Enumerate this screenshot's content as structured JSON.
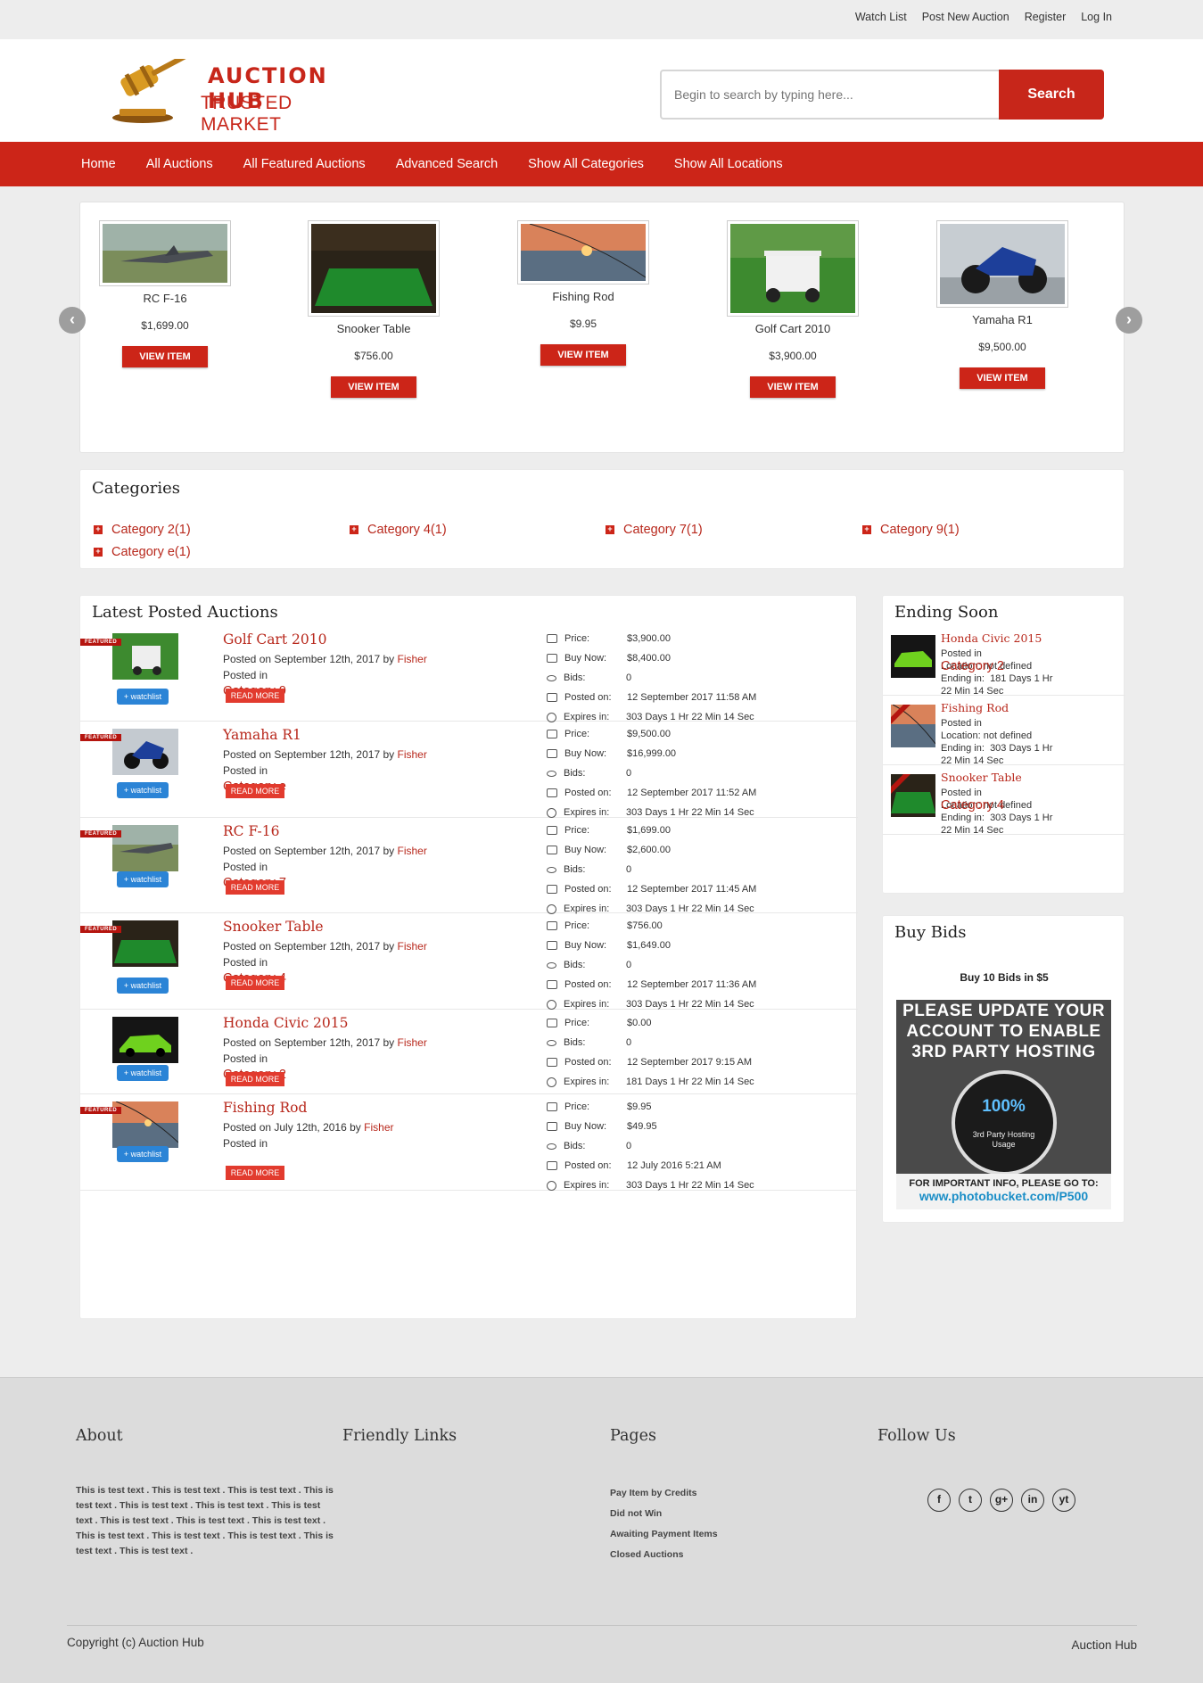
{
  "topbar": {
    "links": [
      "Watch List",
      "Post New Auction",
      "Register",
      "Log In"
    ]
  },
  "header": {
    "logo_line1": "AUCTION HUB",
    "logo_line2": "TRUSTED MARKET",
    "search_placeholder": "Begin to search by typing here...",
    "search_button": "Search"
  },
  "nav": {
    "items": [
      "Home",
      "All Auctions",
      "All Featured Auctions",
      "Advanced Search",
      "Show All Categories",
      "Show All Locations"
    ]
  },
  "carousel": {
    "slides": [
      {
        "name": "RC F-16",
        "price": "$1,699.00",
        "button": "VIEW ITEM"
      },
      {
        "name": "Snooker Table",
        "price": "$756.00",
        "button": "VIEW ITEM"
      },
      {
        "name": "Fishing Rod",
        "price": "$9.95",
        "button": "VIEW ITEM"
      },
      {
        "name": "Golf Cart 2010",
        "price": "$3,900.00",
        "button": "VIEW ITEM"
      },
      {
        "name": "Yamaha R1",
        "price": "$9,500.00",
        "button": "VIEW ITEM"
      }
    ],
    "prev_icon": "chevron-left-icon",
    "next_icon": "chevron-right-icon"
  },
  "categories": {
    "title": "Categories",
    "items": [
      "Category 2(1)",
      "Category 4(1)",
      "Category 7(1)",
      "Category 9(1)",
      "Category e(1)"
    ]
  },
  "latest": {
    "title": "Latest Posted Auctions",
    "featured_label": "FEATURED",
    "watchlist_label": "+ watchlist",
    "readmore_label": "READ MORE",
    "posted_by_label": "by",
    "posted_in_label": "Posted in",
    "detail_labels": {
      "price": "Price:",
      "buy_now": "Buy Now:",
      "bids": "Bids:",
      "posted_on": "Posted on:",
      "expires_in": "Expires in:"
    },
    "items": [
      {
        "title": "Golf Cart 2010",
        "posted": "Posted on September 12th, 2017",
        "author": "Fisher",
        "category": "Category 9",
        "featured": true,
        "price": "$3,900.00",
        "buy_now": "$8,400.00",
        "bids": "0",
        "posted_on": "12 September 2017 11:58 AM",
        "expires_in": "303 Days 1 Hr 22 Min 14 Sec"
      },
      {
        "title": "Yamaha R1",
        "posted": "Posted on September 12th, 2017",
        "author": "Fisher",
        "category": "Category e",
        "featured": true,
        "price": "$9,500.00",
        "buy_now": "$16,999.00",
        "bids": "0",
        "posted_on": "12 September 2017 11:52 AM",
        "expires_in": "303 Days 1 Hr 22 Min 14 Sec"
      },
      {
        "title": "RC F-16",
        "posted": "Posted on September 12th, 2017",
        "author": "Fisher",
        "category": "Category 7",
        "featured": true,
        "price": "$1,699.00",
        "buy_now": "$2,600.00",
        "bids": "0",
        "posted_on": "12 September 2017 11:45 AM",
        "expires_in": "303 Days 1 Hr 22 Min 14 Sec"
      },
      {
        "title": "Snooker Table",
        "posted": "Posted on September 12th, 2017",
        "author": "Fisher",
        "category": "Category 4",
        "featured": true,
        "price": "$756.00",
        "buy_now": "$1,649.00",
        "bids": "0",
        "posted_on": "12 September 2017 11:36 AM",
        "expires_in": "303 Days 1 Hr 22 Min 14 Sec"
      },
      {
        "title": "Honda Civic 2015",
        "posted": "Posted on September 12th, 2017",
        "author": "Fisher",
        "category": "Category 2",
        "featured": false,
        "price": "$0.00",
        "buy_now": "",
        "bids": "0",
        "posted_on": "12 September 2017 9:15 AM",
        "expires_in": "181 Days 1 Hr 22 Min 14 Sec"
      },
      {
        "title": "Fishing Rod",
        "posted": "Posted on July 12th, 2016",
        "author": "Fisher",
        "category": "",
        "featured": true,
        "price": "$9.95",
        "buy_now": "$49.95",
        "bids": "0",
        "posted_on": "12 July 2016 5:21 AM",
        "expires_in": "303 Days 1 Hr 22 Min 14 Sec"
      }
    ]
  },
  "ending_soon": {
    "title": "Ending Soon",
    "location_label": "Location:",
    "ending_label": "Ending in:",
    "items": [
      {
        "title": "Honda Civic 2015",
        "category": "Category 2",
        "location": "not defined",
        "ending": "181 Days 1 Hr",
        "ending2": "22 Min 14 Sec",
        "featured": false
      },
      {
        "title": "Fishing Rod",
        "category": "",
        "location": "not defined",
        "ending": "303 Days 1 Hr",
        "ending2": "22 Min 14 Sec",
        "featured": true
      },
      {
        "title": "Snooker Table",
        "category": "Category 4",
        "location": "not defined",
        "ending": "303 Days 1 Hr",
        "ending2": "22 Min 14 Sec",
        "featured": true
      }
    ]
  },
  "buy_bids": {
    "title": "Buy Bids",
    "offer": "Buy 10 Bids in $5",
    "notice_line1": "PLEASE UPDATE YOUR",
    "notice_line2": "ACCOUNT TO ENABLE",
    "notice_line3": "3RD PARTY HOSTING",
    "gauge_value": "100%",
    "gauge_label1": "3rd Party Hosting",
    "gauge_label2": "Usage",
    "footer_line": "FOR IMPORTANT INFO, PLEASE GO TO:",
    "footer_url": "www.photobucket.com/P500"
  },
  "footer": {
    "about_title": "About",
    "about_text": "This is test text . This is test text . This is test text . This is test text . This is test text . This is test text . This is test text . This is test text . This is test text . This is test text . This is test text . This is test text . This is test text . This is test text . This is test text .",
    "links_title": "Friendly Links",
    "pages_title": "Pages",
    "pages": [
      "Pay Item by Credits",
      "Did not Win",
      "Awaiting Payment Items",
      "Closed Auctions"
    ],
    "follow_title": "Follow Us",
    "social": [
      "f",
      "t",
      "g+",
      "in",
      "yt"
    ],
    "copyright": "Copyright (c) Auction Hub",
    "brand": "Auction Hub"
  },
  "colors": {
    "brand": "#cc2518",
    "link": "#b8281c",
    "watchlist": "#2b84d6"
  }
}
